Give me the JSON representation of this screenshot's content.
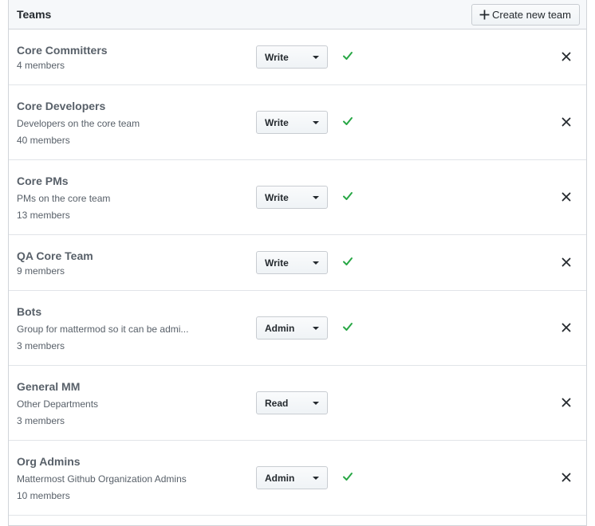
{
  "header": {
    "title": "Teams",
    "create_label": "Create new team",
    "create_icon": "plus-icon"
  },
  "colors": {
    "check": "#28a745",
    "text_muted": "#586069",
    "header_bg": "#f6f8fa"
  },
  "teams": [
    {
      "name": "Core Committers",
      "description": "",
      "members": "4 members",
      "permission": "Write",
      "synced": true
    },
    {
      "name": "Core Developers",
      "description": "Developers on the core team",
      "members": "40 members",
      "permission": "Write",
      "synced": true
    },
    {
      "name": "Core PMs",
      "description": "PMs on the core team",
      "members": "13 members",
      "permission": "Write",
      "synced": true
    },
    {
      "name": "QA Core Team",
      "description": "",
      "members": "9 members",
      "permission": "Write",
      "synced": true
    },
    {
      "name": "Bots",
      "description": "Group for mattermod so it can be admi...",
      "members": "3 members",
      "permission": "Admin",
      "synced": true
    },
    {
      "name": "General MM",
      "description": "Other Departments",
      "members": "3 members",
      "permission": "Read",
      "synced": false
    },
    {
      "name": "Org Admins",
      "description": "Mattermost Github Organization Admins",
      "members": "10 members",
      "permission": "Admin",
      "synced": true
    }
  ]
}
